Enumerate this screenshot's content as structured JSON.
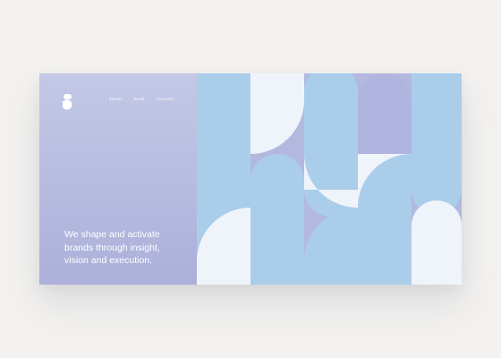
{
  "nav": {
    "items": [
      "about",
      "work",
      "contact"
    ]
  },
  "hero": {
    "lines": [
      "We shape and activate",
      "brands through insight,",
      "vision and execution."
    ]
  },
  "colors": {
    "background": "#f3f2f0",
    "panel": "#b6bbe0",
    "tile_lavender": "#b1b8dd",
    "shape_blue": "#aacdea",
    "shape_white": "#eff4fb",
    "text": "#ffffff"
  }
}
